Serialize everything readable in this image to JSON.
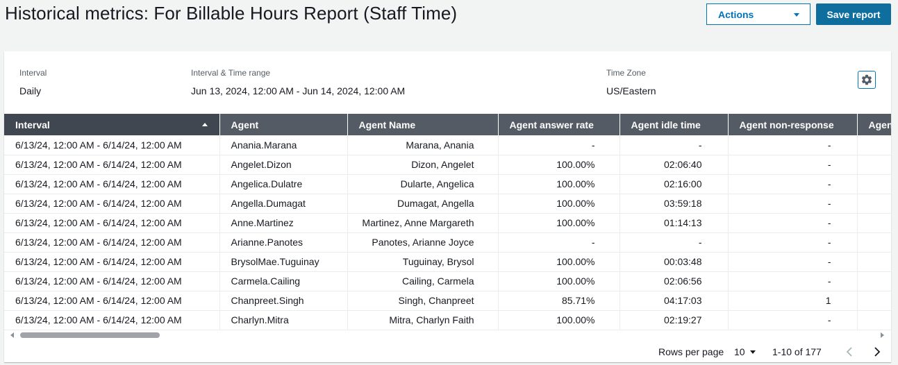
{
  "header": {
    "title": "Historical metrics: For Billable Hours Report (Staff Time)",
    "actions_label": "Actions",
    "save_label": "Save report"
  },
  "meta": {
    "interval_label": "Interval",
    "interval_value": "Daily",
    "range_label": "Interval & Time range",
    "range_value": "Jun 13, 2024, 12:00 AM - Jun 14, 2024, 12:00 AM",
    "timezone_label": "Time Zone",
    "timezone_value": "US/Eastern"
  },
  "table": {
    "columns": [
      "Interval",
      "Agent",
      "Agent Name",
      "Agent answer rate",
      "Agent idle time",
      "Agent non-response",
      "Agen"
    ],
    "sorted_column": "Interval",
    "sort_direction": "ascending",
    "rows": [
      [
        "6/13/24, 12:00 AM - 6/14/24, 12:00 AM",
        "Anania.Marana",
        "Marana, Anania",
        "-",
        "-",
        "-"
      ],
      [
        "6/13/24, 12:00 AM - 6/14/24, 12:00 AM",
        "Angelet.Dizon",
        "Dizon, Angelet",
        "100.00%",
        "02:06:40",
        "-"
      ],
      [
        "6/13/24, 12:00 AM - 6/14/24, 12:00 AM",
        "Angelica.Dulatre",
        "Dularte, Angelica",
        "100.00%",
        "02:16:00",
        "-"
      ],
      [
        "6/13/24, 12:00 AM - 6/14/24, 12:00 AM",
        "Angella.Dumagat",
        "Dumagat, Angella",
        "100.00%",
        "03:59:18",
        "-"
      ],
      [
        "6/13/24, 12:00 AM - 6/14/24, 12:00 AM",
        "Anne.Martinez",
        "Martinez, Anne Margareth",
        "100.00%",
        "01:14:13",
        "-"
      ],
      [
        "6/13/24, 12:00 AM - 6/14/24, 12:00 AM",
        "Arianne.Panotes",
        "Panotes, Arianne Joyce",
        "-",
        "-",
        "-"
      ],
      [
        "6/13/24, 12:00 AM - 6/14/24, 12:00 AM",
        "BrysolMae.Tuguinay",
        "Tuguinay, Brysol",
        "100.00%",
        "00:03:48",
        "-"
      ],
      [
        "6/13/24, 12:00 AM - 6/14/24, 12:00 AM",
        "Carmela.Cailing",
        "Cailing, Carmela",
        "100.00%",
        "02:06:56",
        "-"
      ],
      [
        "6/13/24, 12:00 AM - 6/14/24, 12:00 AM",
        "Chanpreet.Singh",
        "Singh, Chanpreet",
        "85.71%",
        "04:17:03",
        "1"
      ],
      [
        "6/13/24, 12:00 AM - 6/14/24, 12:00 AM",
        "Charlyn.Mitra",
        "Mitra, Charlyn Faith",
        "100.00%",
        "02:19:27",
        "-"
      ]
    ]
  },
  "pagination": {
    "rows_per_page_label": "Rows per page",
    "rows_per_page_value": "10",
    "range_text": "1-10 of 177"
  },
  "icons": {
    "settings": "gear-icon",
    "prev": "chevron-left-icon",
    "next": "chevron-right-icon",
    "dropdown": "caret-down-icon",
    "sort": "sort-ascending-icon"
  },
  "colors": {
    "accent": "#0073bb",
    "primary_button": "#0e6f9f",
    "table_header": "#545b64",
    "table_header_sorted": "#414750"
  }
}
